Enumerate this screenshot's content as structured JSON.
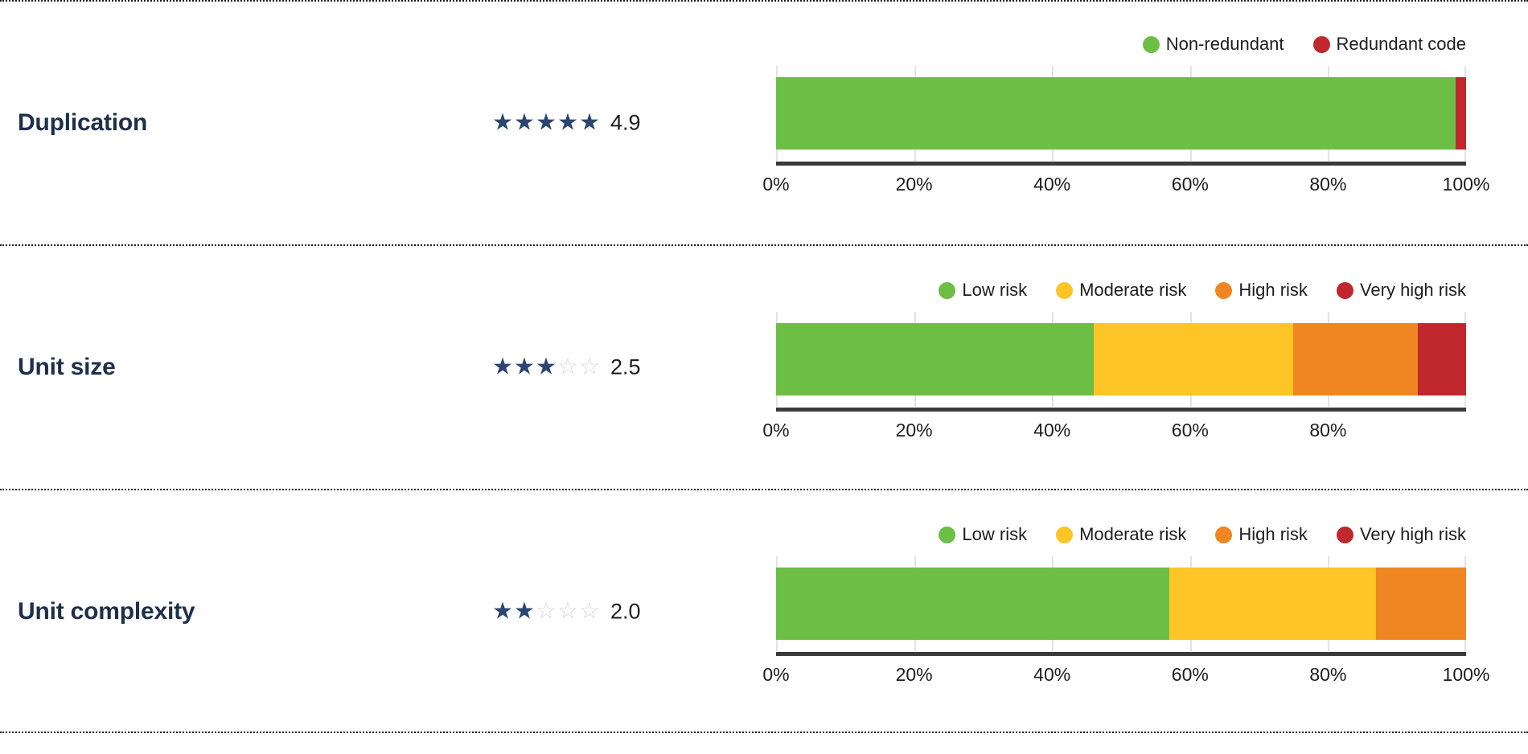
{
  "colors": {
    "green": "#6CBE45",
    "yellow": "#FFC425",
    "orange": "#F08621",
    "red": "#C0282E",
    "star_filled": "#2b4570",
    "star_empty": "#d9d9d9",
    "label_text": "#1d3049",
    "axis": "#3a3a3a"
  },
  "rows": [
    {
      "name": "Duplication",
      "rating_value": "4.9",
      "stars_filled": 5,
      "stars_total": 5,
      "legend": [
        {
          "label": "Non-redundant",
          "color": "#6CBE45"
        },
        {
          "label": "Redundant code",
          "color": "#C0282E"
        }
      ],
      "ticks": [
        "0%",
        "20%",
        "40%",
        "60%",
        "80%",
        "100%"
      ],
      "tick_positions": [
        0,
        20,
        40,
        60,
        80,
        100
      ]
    },
    {
      "name": "Unit size",
      "rating_value": "2.5",
      "stars_filled": 3,
      "stars_total": 5,
      "legend": [
        {
          "label": "Low risk",
          "color": "#6CBE45"
        },
        {
          "label": "Moderate risk",
          "color": "#FFC425"
        },
        {
          "label": "High risk",
          "color": "#F08621"
        },
        {
          "label": "Very high risk",
          "color": "#C0282E"
        }
      ],
      "ticks": [
        "0%",
        "20%",
        "40%",
        "60%",
        "80%"
      ],
      "tick_positions": [
        0,
        20,
        40,
        60,
        80
      ]
    },
    {
      "name": "Unit complexity",
      "rating_value": "2.0",
      "stars_filled": 2,
      "stars_total": 5,
      "legend": [
        {
          "label": "Low risk",
          "color": "#6CBE45"
        },
        {
          "label": "Moderate risk",
          "color": "#FFC425"
        },
        {
          "label": "High risk",
          "color": "#F08621"
        },
        {
          "label": "Very high risk",
          "color": "#C0282E"
        }
      ],
      "ticks": [
        "0%",
        "20%",
        "40%",
        "60%",
        "80%",
        "100%"
      ],
      "tick_positions": [
        0,
        20,
        40,
        60,
        80,
        100
      ]
    }
  ],
  "chart_data": [
    {
      "type": "bar",
      "title": "Duplication",
      "orientation": "horizontal",
      "stacked": true,
      "xlabel": "",
      "ylabel": "",
      "xlim": [
        0,
        100
      ],
      "grid": true,
      "legend_position": "top-right",
      "tick_labels": [
        "0%",
        "20%",
        "40%",
        "60%",
        "80%",
        "100%"
      ],
      "categories": [
        "Duplication"
      ],
      "series": [
        {
          "name": "Non-redundant",
          "color": "#6CBE45",
          "values": [
            98.5
          ]
        },
        {
          "name": "Redundant code",
          "color": "#C0282E",
          "values": [
            1.5
          ]
        }
      ],
      "rating": 4.9
    },
    {
      "type": "bar",
      "title": "Unit size",
      "orientation": "horizontal",
      "stacked": true,
      "xlabel": "",
      "ylabel": "",
      "xlim": [
        0,
        100
      ],
      "grid": true,
      "legend_position": "top-right",
      "tick_labels": [
        "0%",
        "20%",
        "40%",
        "60%",
        "80%"
      ],
      "categories": [
        "Unit size"
      ],
      "series": [
        {
          "name": "Low risk",
          "color": "#6CBE45",
          "values": [
            46
          ]
        },
        {
          "name": "Moderate risk",
          "color": "#FFC425",
          "values": [
            29
          ]
        },
        {
          "name": "High risk",
          "color": "#F08621",
          "values": [
            18
          ]
        },
        {
          "name": "Very high risk",
          "color": "#C0282E",
          "values": [
            7
          ]
        }
      ],
      "rating": 2.5
    },
    {
      "type": "bar",
      "title": "Unit complexity",
      "orientation": "horizontal",
      "stacked": true,
      "xlabel": "",
      "ylabel": "",
      "xlim": [
        0,
        100
      ],
      "grid": true,
      "legend_position": "top-right",
      "tick_labels": [
        "0%",
        "20%",
        "40%",
        "60%",
        "80%",
        "100%"
      ],
      "categories": [
        "Unit complexity"
      ],
      "series": [
        {
          "name": "Low risk",
          "color": "#6CBE45",
          "values": [
            57
          ]
        },
        {
          "name": "Moderate risk",
          "color": "#FFC425",
          "values": [
            30
          ]
        },
        {
          "name": "High risk",
          "color": "#F08621",
          "values": [
            13
          ]
        },
        {
          "name": "Very high risk",
          "color": "#C0282E",
          "values": [
            0
          ]
        }
      ],
      "rating": 2.0
    }
  ]
}
